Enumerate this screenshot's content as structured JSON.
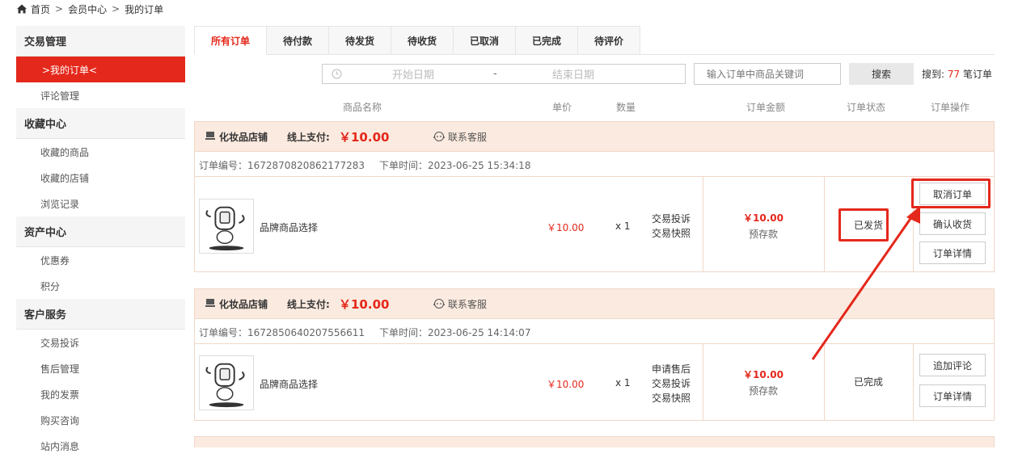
{
  "breadcrumb": {
    "home": "首页",
    "sep": ">",
    "member": "会员中心",
    "current": "我的订单"
  },
  "sidebar": {
    "sections": [
      {
        "title": "交易管理",
        "items": [
          {
            "label": ">我的订单<",
            "active": true
          },
          {
            "label": "评论管理"
          }
        ]
      },
      {
        "title": "收藏中心",
        "items": [
          {
            "label": "收藏的商品"
          },
          {
            "label": "收藏的店铺"
          },
          {
            "label": "浏览记录"
          }
        ]
      },
      {
        "title": "资产中心",
        "items": [
          {
            "label": "优惠券"
          },
          {
            "label": "积分"
          }
        ]
      },
      {
        "title": "客户服务",
        "items": [
          {
            "label": "交易投诉"
          },
          {
            "label": "售后管理"
          },
          {
            "label": "我的发票"
          },
          {
            "label": "购买咨询"
          },
          {
            "label": "站内消息"
          }
        ]
      }
    ]
  },
  "tabs": [
    "所有订单",
    "待付款",
    "待发货",
    "待收货",
    "已取消",
    "已完成",
    "待评价"
  ],
  "search": {
    "start_placeholder": "开始日期",
    "dash": "-",
    "end_placeholder": "结束日期",
    "keyword_placeholder": "输入订单中商品关键词",
    "button": "搜索",
    "result_prefix": "搜到:",
    "result_count": "77",
    "result_suffix": "笔订单"
  },
  "table_headers": {
    "name": "商品名称",
    "price": "单价",
    "qty": "数量",
    "amount": "订单金额",
    "status": "订单状态",
    "ops": "订单操作"
  },
  "orders": [
    {
      "shop": "化妆品店铺",
      "pay_label": "线上支付:",
      "pay_amount": "￥10.00",
      "cs": "联系客服",
      "order_no": "订单编号：1672870820862177283",
      "order_time": "下单时间：2023-06-25 15:34:18",
      "product": "品牌商品选择",
      "unit_price": "￥10.00",
      "qty": "x 1",
      "services": [
        "交易投诉",
        "交易快照"
      ],
      "amount": "￥10.00",
      "amount_note": "预存款",
      "status": "已发货",
      "actions": [
        "取消订单",
        "确认收货",
        "订单详情"
      ]
    },
    {
      "shop": "化妆品店铺",
      "pay_label": "线上支付:",
      "pay_amount": "￥10.00",
      "cs": "联系客服",
      "order_no": "订单编号：1672850640207556611",
      "order_time": "下单时间：2023-06-25 14:14:07",
      "product": "品牌商品选择",
      "unit_price": "￥10.00",
      "qty": "x 1",
      "services": [
        "申请售后",
        "交易投诉",
        "交易快照"
      ],
      "amount": "￥10.00",
      "amount_note": "预存款",
      "status": "已完成",
      "actions": [
        "追加评论",
        "订单详情"
      ]
    }
  ],
  "colors": {
    "accent": "#e4281b",
    "order_head_bg": "#fbeadf"
  }
}
